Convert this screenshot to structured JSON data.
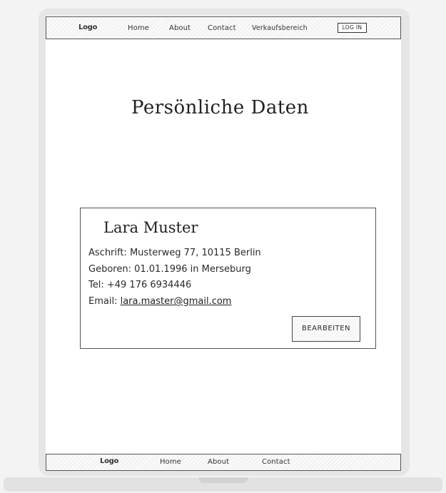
{
  "top_nav": {
    "logo": "Logo",
    "items": [
      {
        "label": "Home"
      },
      {
        "label": "About"
      },
      {
        "label": "Contact"
      },
      {
        "label": "Verkaufsbereich"
      }
    ],
    "login_label": "LOG IN"
  },
  "main": {
    "title": "Persönliche Daten"
  },
  "profile": {
    "name": "Lara Muster",
    "address_line": "Aschrift: Musterweg 77, 10115 Berlin",
    "birth_line": "Geboren: 01.01.1996 in Merseburg",
    "phone_line": "Tel: +49 176 6934446",
    "email_label": "Email:",
    "email": "lara.master@gmail.com",
    "edit_label": "BEARBEITEN"
  },
  "footer_nav": {
    "logo": "Logo",
    "items": [
      {
        "label": "Home"
      },
      {
        "label": "About"
      },
      {
        "label": "Contact"
      }
    ]
  }
}
